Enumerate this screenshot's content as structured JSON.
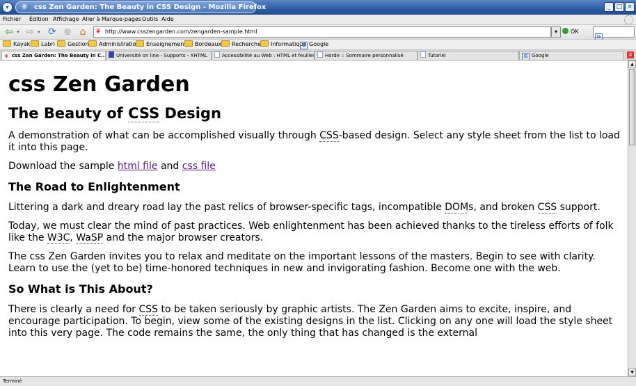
{
  "window": {
    "title": "css Zen Garden: The Beauty in CSS Design - Mozilla Firefox",
    "controls": {
      "minimize": "_",
      "maximize": "□",
      "close": "×"
    }
  },
  "menubar": {
    "items": [
      {
        "label": "Fichier"
      },
      {
        "label": "Édition"
      },
      {
        "label": "Affichage"
      },
      {
        "label": "Aller à"
      },
      {
        "label": "Marque-pages"
      },
      {
        "label": "Outils"
      },
      {
        "label": "Aide"
      }
    ]
  },
  "navbar": {
    "url": "http://www.csszengarden.com/zengarden-sample.html",
    "go_label": "OK",
    "search_placeholder": ""
  },
  "bookmarks": {
    "items": [
      {
        "label": "Kayak",
        "type": "folder"
      },
      {
        "label": "Labri",
        "type": "folder"
      },
      {
        "label": "Gestion",
        "type": "folder"
      },
      {
        "label": "Administration",
        "type": "folder"
      },
      {
        "label": "Enseignements",
        "type": "folder"
      },
      {
        "label": "Bordeaux",
        "type": "folder"
      },
      {
        "label": "Recherche",
        "type": "folder"
      },
      {
        "label": "Informatique",
        "type": "folder"
      },
      {
        "label": "Google",
        "type": "google"
      }
    ]
  },
  "tabs": {
    "items": [
      {
        "label": "css Zen Garden: The Beauty in C...",
        "active": true
      },
      {
        "label": "Université on line - Supports - XHTML",
        "active": false
      },
      {
        "label": "Accessibilité au Web : HTML et feuilles d...",
        "active": false
      },
      {
        "label": "Horde :: Sommaire personnalisé",
        "active": false
      },
      {
        "label": "Tutoriel",
        "active": false
      },
      {
        "label": "Google",
        "active": false
      }
    ]
  },
  "page": {
    "h1": "css Zen Garden",
    "h2_prefix": "The Beauty of ",
    "h2_abbr": "CSS",
    "h2_suffix": " Design",
    "intro_p1_a": "A demonstration of what can be accomplished visually through ",
    "intro_p1_abbr": "CSS",
    "intro_p1_b": "-based design. Select any style sheet from the list to load it into this page.",
    "intro_p2_a": "Download the sample ",
    "intro_p2_link1": "html file",
    "intro_p2_b": " and ",
    "intro_p2_link2": "css file",
    "s1_title": "The Road to Enlightenment",
    "s1_p1_a": "Littering a dark and dreary road lay the past relics of browser-specific tags, incompatible ",
    "s1_p1_abbr1": "DOM",
    "s1_p1_b": "s, and broken ",
    "s1_p1_abbr2": "CSS",
    "s1_p1_c": " support.",
    "s1_p2_a": "Today, we must clear the mind of past practices. Web enlightenment has been achieved thanks to the tireless efforts of folk like the ",
    "s1_p2_abbr1": "W3C",
    "s1_p2_b": ", ",
    "s1_p2_abbr2": "WaSP",
    "s1_p2_c": " and the major browser creators.",
    "s1_p3": "The css Zen Garden invites you to relax and meditate on the important lessons of the masters. Begin to see with clarity. Learn to use the (yet to be) time-honored techniques in new and invigorating fashion. Become one with the web.",
    "s2_title": "So What is This About?",
    "s2_p1_a": "There is clearly a need for ",
    "s2_p1_abbr": "CSS",
    "s2_p1_b": " to be taken seriously by graphic artists. The Zen Garden aims to excite, inspire, and encourage participation. To begin, view some of the existing designs in the list. Clicking on any one will load the style sheet into this very page. The code remains the same, the only thing that has changed is the external"
  },
  "status": {
    "text": "Terminé"
  },
  "colors": {
    "titlebar": "#2f5fa6",
    "link_visited": "#551a8b",
    "go_icon": "#2da02d",
    "tab_close": "#dd3333"
  }
}
